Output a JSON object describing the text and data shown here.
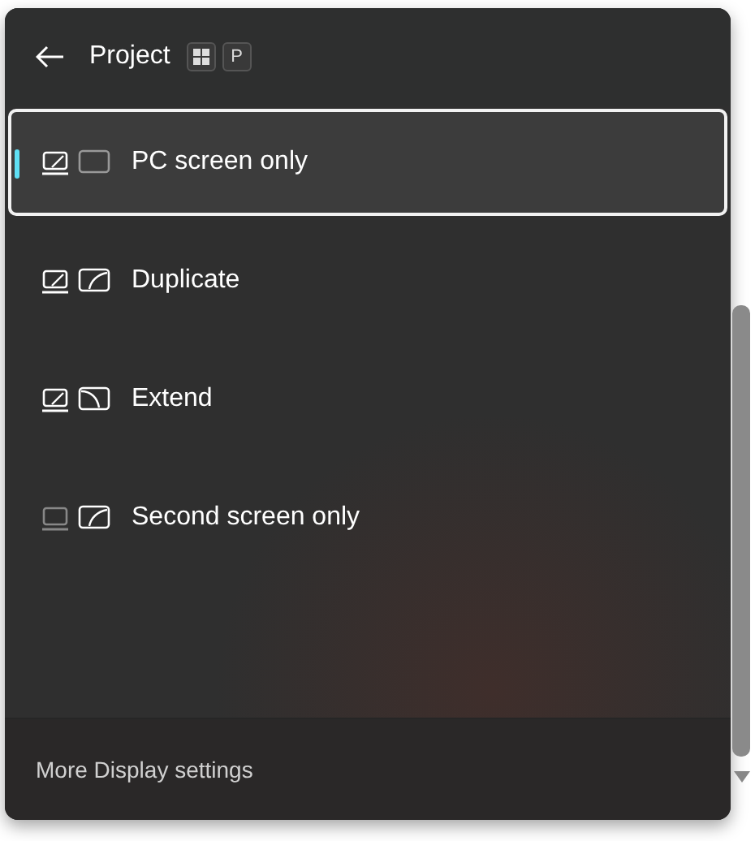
{
  "header": {
    "title": "Project",
    "shortcut_key": "P"
  },
  "options": [
    {
      "label": "PC screen only",
      "kind": "pc-only",
      "selected": true
    },
    {
      "label": "Duplicate",
      "kind": "duplicate",
      "selected": false
    },
    {
      "label": "Extend",
      "kind": "extend",
      "selected": false
    },
    {
      "label": "Second screen only",
      "kind": "second-only",
      "selected": false
    }
  ],
  "footer": {
    "link": "More Display settings"
  }
}
